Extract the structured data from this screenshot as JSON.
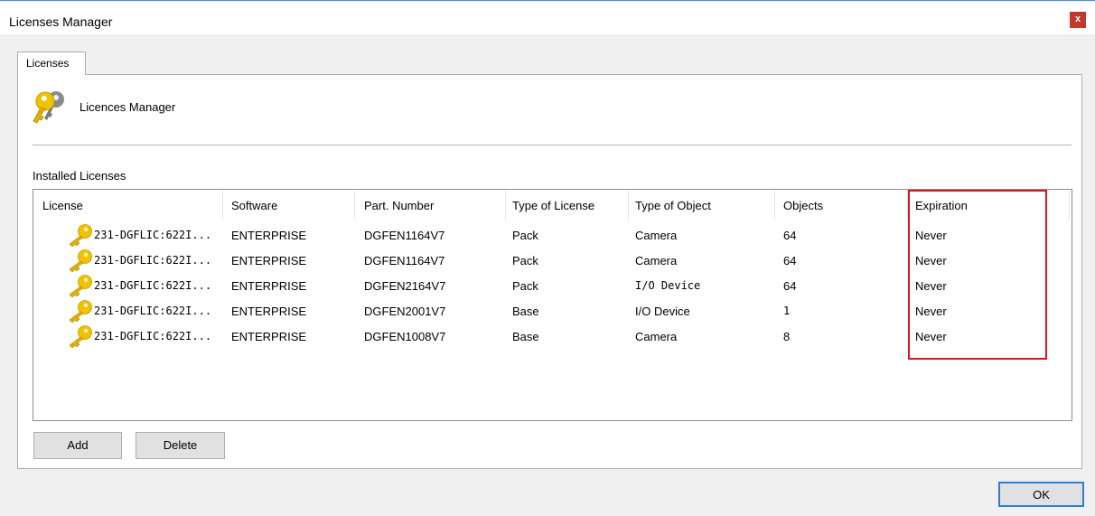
{
  "window": {
    "title": "Licenses Manager",
    "close_label": "x"
  },
  "tabs": [
    {
      "label": "Licenses"
    }
  ],
  "header": {
    "label": "Licences Manager",
    "icon": "key-icon"
  },
  "installed": {
    "section_label": "Installed Licenses",
    "columns": [
      "License",
      "Software",
      "Part. Number",
      "Type of License",
      "Type of Object",
      "Objects",
      "Expiration"
    ],
    "rows": [
      {
        "license": "231-DGFLIC:622I...",
        "software": "ENTERPRISE",
        "part_number": "DGFEN1164V7",
        "type_of_license": "Pack",
        "type_of_object": "Camera",
        "objects": "64",
        "expiration": "Never"
      },
      {
        "license": "231-DGFLIC:622I...",
        "software": "ENTERPRISE",
        "part_number": "DGFEN1164V7",
        "type_of_license": "Pack",
        "type_of_object": "Camera",
        "objects": "64",
        "expiration": "Never"
      },
      {
        "license": "231-DGFLIC:622I...",
        "software": "ENTERPRISE",
        "part_number": "DGFEN2164V7",
        "type_of_license": "Pack",
        "type_of_object": "I/O Device",
        "objects": "64",
        "expiration": "Never"
      },
      {
        "license": "231-DGFLIC:622I...",
        "software": "ENTERPRISE",
        "part_number": "DGFEN2001V7",
        "type_of_license": "Base",
        "type_of_object": "I/O Device",
        "objects": "1",
        "expiration": "Never"
      },
      {
        "license": "231-DGFLIC:622I...",
        "software": "ENTERPRISE",
        "part_number": "DGFEN1008V7",
        "type_of_license": "Base",
        "type_of_object": "Camera",
        "objects": "8",
        "expiration": "Never"
      }
    ]
  },
  "buttons": {
    "add": "Add",
    "delete": "Delete",
    "ok": "OK"
  },
  "colors": {
    "highlight": "#e0141e",
    "ok_border": "#2f7cd1",
    "close_bg": "#c0392b",
    "key_gold": "#f2c200"
  }
}
